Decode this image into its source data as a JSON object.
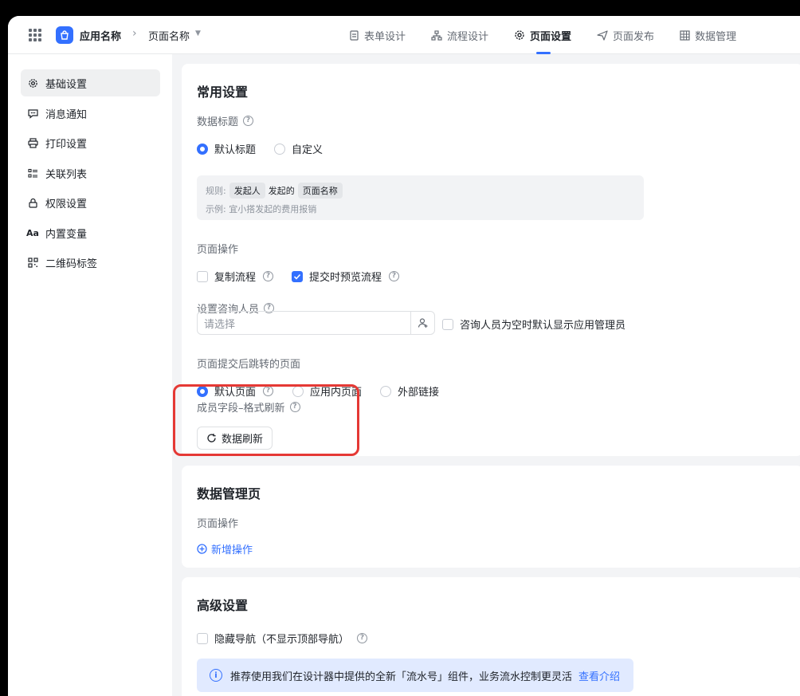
{
  "header": {
    "app_name": "应用名称",
    "page_name": "页面名称",
    "tabs": [
      {
        "label": "表单设计",
        "icon": "form-icon"
      },
      {
        "label": "流程设计",
        "icon": "flow-icon"
      },
      {
        "label": "页面设置",
        "icon": "gear-icon",
        "active": true
      },
      {
        "label": "页面发布",
        "icon": "send-icon"
      },
      {
        "label": "数据管理",
        "icon": "table-icon"
      }
    ]
  },
  "sidebar": {
    "items": [
      {
        "label": "基础设置",
        "icon": "gear-icon",
        "active": true
      },
      {
        "label": "消息通知",
        "icon": "message-icon"
      },
      {
        "label": "打印设置",
        "icon": "printer-icon"
      },
      {
        "label": "关联列表",
        "icon": "list-icon"
      },
      {
        "label": "权限设置",
        "icon": "lock-icon"
      },
      {
        "label": "内置变量",
        "icon": "variable-icon"
      },
      {
        "label": "二维码标签",
        "icon": "qrcode-icon"
      }
    ]
  },
  "general": {
    "title": "常用设置",
    "data_title_label": "数据标题",
    "data_title_options": [
      "默认标题",
      "自定义"
    ],
    "data_title_selected": "默认标题",
    "rule_prefix": "规则:",
    "rule_token1": "发起人",
    "rule_middle": "发起的",
    "rule_token2": "页面名称",
    "example": "示例:  宜小搭发起的费用报销",
    "page_ops_label": "页面操作",
    "copy_flow": {
      "label": "复制流程",
      "checked": false
    },
    "preview_flow": {
      "label": "提交时预览流程",
      "checked": true
    },
    "consultant_label": "设置咨询人员",
    "consultant_placeholder": "请选择",
    "consultant_default": {
      "label": "咨询人员为空时默认显示应用管理员",
      "checked": false
    },
    "redirect_label": "页面提交后跳转的页面",
    "redirect_options": [
      "默认页面",
      "应用内页面",
      "外部链接"
    ],
    "redirect_selected": "默认页面",
    "member_field_label": "成员字段–格式刷新",
    "refresh_button": "数据刷新"
  },
  "data_manage": {
    "title": "数据管理页",
    "page_ops_label": "页面操作",
    "add_action": "新增操作"
  },
  "advanced": {
    "title": "高级设置",
    "hide_nav": {
      "label": "隐藏导航（不显示顶部导航）",
      "checked": false
    },
    "info_text": "推荐使用我们在设计器中提供的全新「流水号」组件，业务流水控制更灵活",
    "info_link": "查看介绍"
  },
  "colors": {
    "accent": "#3370ff",
    "highlight": "#e53935"
  }
}
